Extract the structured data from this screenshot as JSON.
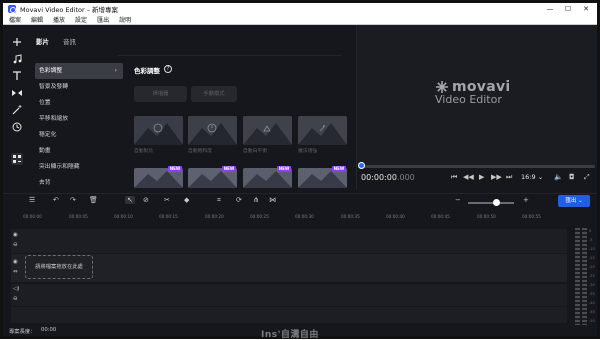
{
  "window": {
    "title": "Movavi Video Editor – 新增專案",
    "minimize": "—",
    "maximize": "☐",
    "close": "✕"
  },
  "menu": [
    "檔案",
    "編輯",
    "播放",
    "設定",
    "匯出",
    "說明"
  ],
  "rail_icons": [
    "plus-icon",
    "music-note-icon",
    "text-icon",
    "transitions-icon",
    "magic-wand-icon",
    "clock-icon",
    "filters-icon"
  ],
  "tabs": {
    "video": "影片",
    "audio": "音訊"
  },
  "categories": [
    "色彩調整",
    "智景及發轉",
    "位置",
    "平移和縮放",
    "穩定化",
    "動畫",
    "突出顯示和隱藏",
    "去背"
  ],
  "panel": {
    "title": "色彩調整",
    "buttons": [
      "掃描器",
      "手動模式"
    ]
  },
  "presets": {
    "row1": [
      "自動對比",
      "自動飽和度",
      "自動白平衡",
      "魔法增強"
    ],
    "new_badge": "NEW"
  },
  "preview": {
    "logo_brand": "movavi",
    "logo_product": "Video Editor"
  },
  "player": {
    "timecode_main": "00:00:00",
    "timecode_frac": ".000",
    "ratio": "16:9",
    "ratio_caret": "⌄"
  },
  "timeline": {
    "ruler": [
      "00:00:00",
      "00:00:05",
      "00:00:10",
      "00:00:15",
      "00:00:20",
      "00:00:25",
      "00:00:30",
      "00:00:35",
      "00:00:40",
      "00:00:45",
      "00:00:50",
      "00:00:55"
    ],
    "drop_hint": "請將檔案拖放在此處",
    "export_label": "匯出",
    "zoom_level": 0.62
  },
  "meter_labels": [
    "0",
    "-5",
    "-10",
    "-15",
    "-20",
    "-25",
    "-30",
    "-35",
    "-40",
    "-45",
    "-50"
  ],
  "status": {
    "duration_label": "專案長度：",
    "duration_value": "00:00"
  },
  "watermark": "Ins'自溝自由",
  "colors": {
    "accent": "#1f5fe0",
    "new_badge": "#8a3cff",
    "background": "#16171c"
  }
}
